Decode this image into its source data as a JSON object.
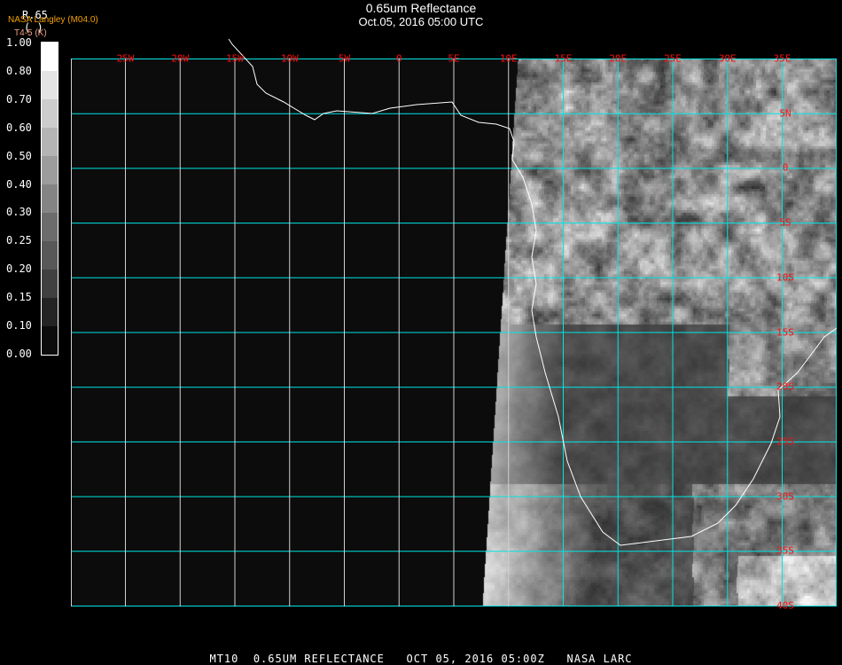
{
  "header": {
    "title": "0.65um Reflectance",
    "subtitle": "Oct.05, 2016 05:00 UTC",
    "producer": "NASA Langley (M04.0)",
    "channel": "T4-5 (K)",
    "colorbar_variable": "R.65",
    "colorbar_unit": "(  )"
  },
  "colorbar": {
    "labels": [
      "1.00",
      "0.80",
      "0.70",
      "0.60",
      "0.50",
      "0.40",
      "0.30",
      "0.25",
      "0.20",
      "0.15",
      "0.10",
      "0.00"
    ],
    "colors": [
      "#ffffff",
      "#e4e4e4",
      "#cccccc",
      "#b4b4b4",
      "#9c9c9c",
      "#848484",
      "#6c6c6c",
      "#585858",
      "#404040",
      "#242424",
      "#0c0c0c"
    ]
  },
  "map": {
    "longitude_labels": [
      "25W",
      "20W",
      "15W",
      "10W",
      "5W",
      "0",
      "5E",
      "10E",
      "15E",
      "20E",
      "25E",
      "30E",
      "35E"
    ],
    "latitude_labels": [
      "5N",
      "0",
      "5S",
      "10S",
      "15S",
      "20S",
      "25S",
      "30S",
      "35S",
      "40S"
    ],
    "grid_color": "#00e5e5",
    "label_color": "#ff1010",
    "coast_color": "#ffffff"
  },
  "footer": {
    "text": "MT10  0.65UM REFLECTANCE   OCT 05, 2016 05:00Z   NASA LARC"
  }
}
